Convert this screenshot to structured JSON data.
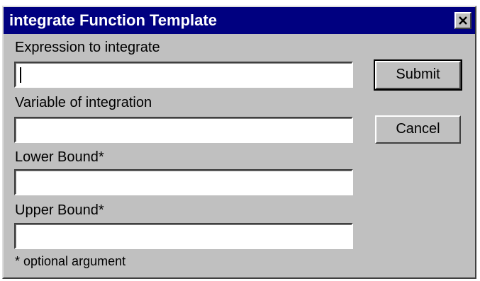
{
  "window": {
    "title": "integrate Function Template"
  },
  "fields": [
    {
      "label": "Expression to integrate",
      "value": "",
      "placeholder": ""
    },
    {
      "label": "Variable of integration",
      "value": "",
      "placeholder": ""
    },
    {
      "label": "Lower Bound*",
      "value": "",
      "placeholder": ""
    },
    {
      "label": "Upper Bound*",
      "value": "",
      "placeholder": ""
    }
  ],
  "buttons": {
    "submit_label": "Submit",
    "cancel_label": "Cancel"
  },
  "footnote": "* optional argument",
  "icons": {
    "close": "close-icon"
  },
  "colors": {
    "titlebar": "#000080",
    "title_text": "#ffffff",
    "window_bg": "#c0c0c0",
    "field_bg": "#ffffff"
  }
}
